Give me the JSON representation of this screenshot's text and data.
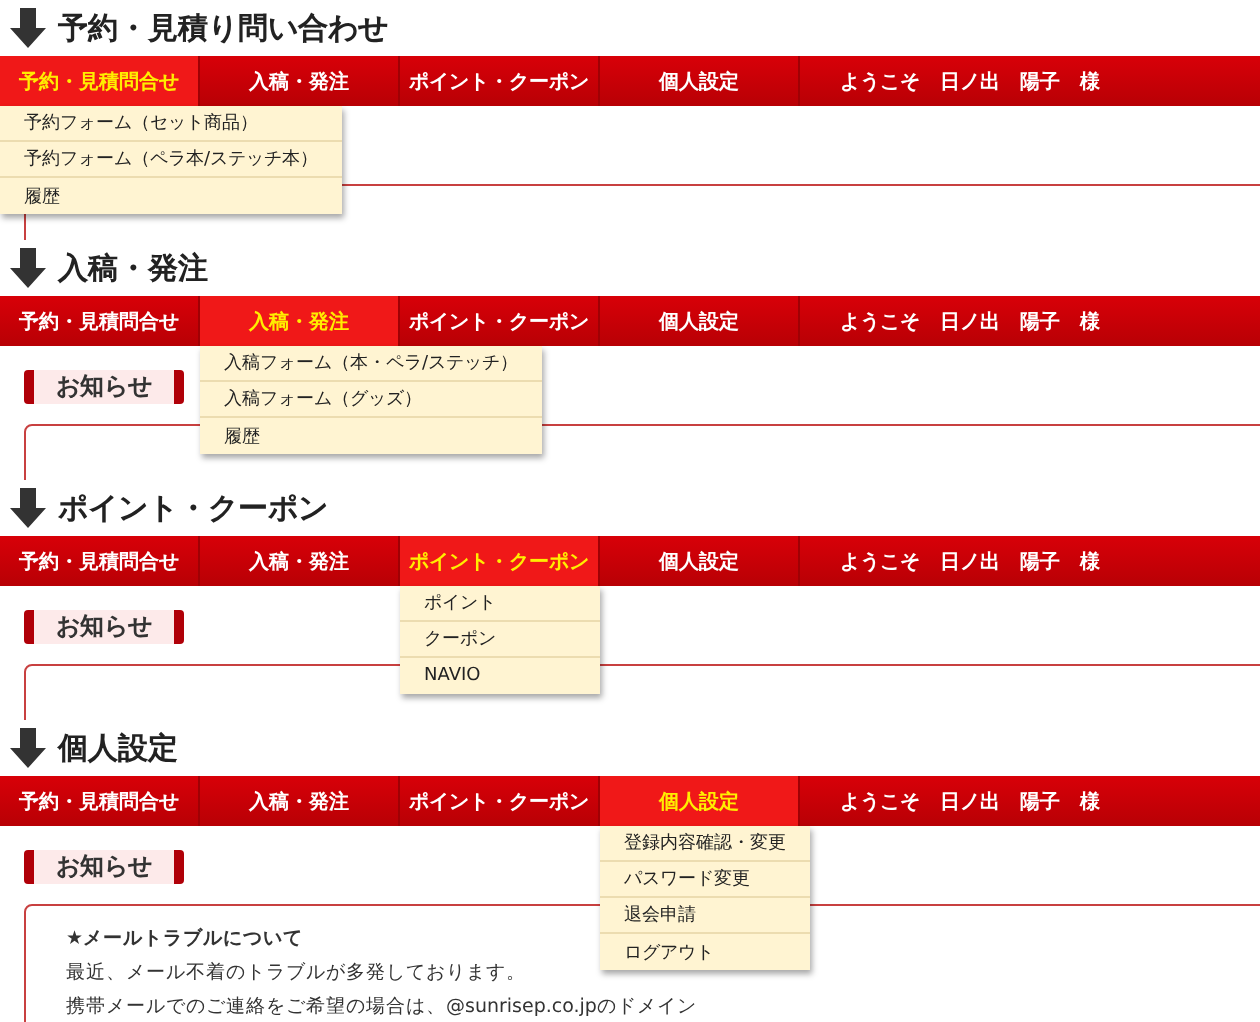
{
  "sections": [
    {
      "heading": "予約・見積り問い合わせ",
      "tabs": [
        {
          "label": "予約・見積問合せ",
          "selected": true
        },
        {
          "label": "入稿・発注",
          "selected": false
        },
        {
          "label": "ポイント・クーポン",
          "selected": false
        },
        {
          "label": "個人設定",
          "selected": false
        }
      ],
      "welcome": "ようこそ　日ノ出　陽子　様",
      "menu": [
        "予約フォーム（セット商品）",
        "予約フォーム（ペラ本/ステッチ本）",
        "履歴"
      ]
    },
    {
      "heading": "入稿・発注",
      "tabs": [
        {
          "label": "予約・見積問合せ",
          "selected": false
        },
        {
          "label": "入稿・発注",
          "selected": true
        },
        {
          "label": "ポイント・クーポン",
          "selected": false
        },
        {
          "label": "個人設定",
          "selected": false
        }
      ],
      "welcome": "ようこそ　日ノ出　陽子　様",
      "menu": [
        "入稿フォーム（本・ペラ/ステッチ）",
        "入稿フォーム（グッズ）",
        "履歴"
      ],
      "notice_heading": "お知らせ"
    },
    {
      "heading": "ポイント・クーポン",
      "tabs": [
        {
          "label": "予約・見積問合せ",
          "selected": false
        },
        {
          "label": "入稿・発注",
          "selected": false
        },
        {
          "label": "ポイント・クーポン",
          "selected": true
        },
        {
          "label": "個人設定",
          "selected": false
        }
      ],
      "welcome": "ようこそ　日ノ出　陽子　様",
      "menu": [
        "ポイント",
        "クーポン",
        "NAVIO"
      ],
      "notice_heading": "お知らせ"
    },
    {
      "heading": "個人設定",
      "tabs": [
        {
          "label": "予約・見積問合せ",
          "selected": false
        },
        {
          "label": "入稿・発注",
          "selected": false
        },
        {
          "label": "ポイント・クーポン",
          "selected": false
        },
        {
          "label": "個人設定",
          "selected": true
        }
      ],
      "welcome": "ようこそ　日ノ出　陽子　様",
      "menu": [
        "登録内容確認・変更",
        "パスワード変更",
        "退会申請",
        "ログアウト"
      ],
      "notice_heading": "お知らせ",
      "notice": {
        "title": "★メールトラブルについて",
        "lines": [
          "最近、メール不着のトラブルが多発しております。",
          "携帯メールでのご連絡をご希望の場合は、@sunrisep.co.jpのドメイン"
        ]
      }
    }
  ]
}
